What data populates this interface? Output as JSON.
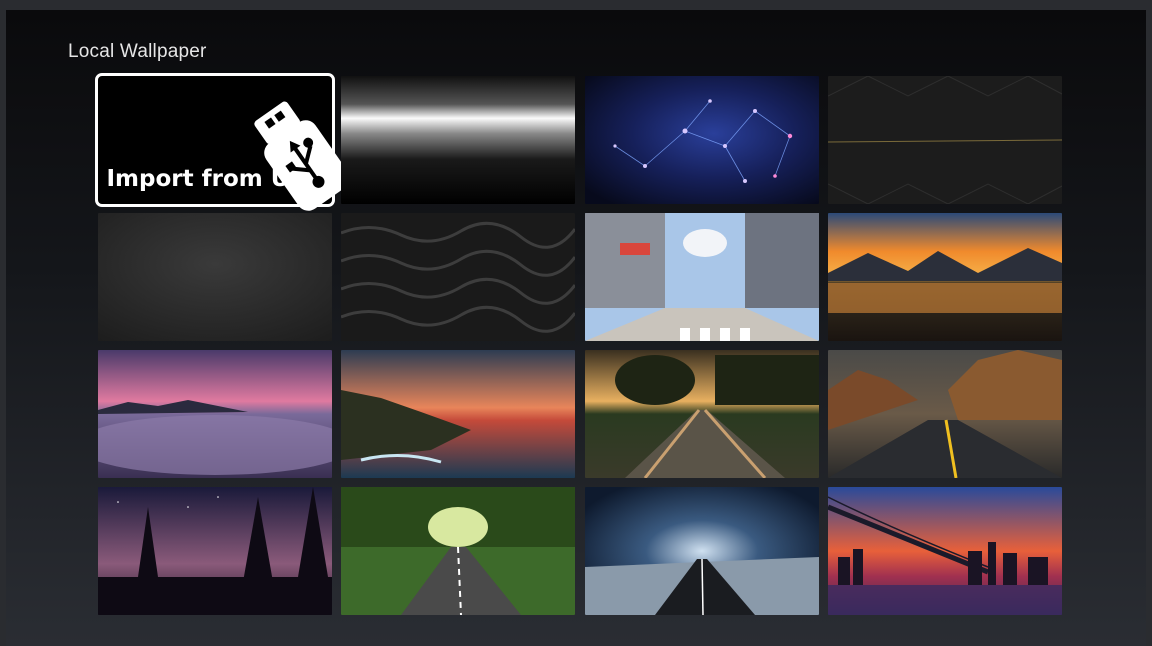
{
  "page": {
    "title": "Local Wallpaper"
  },
  "import_tile": {
    "label": "Import from USB",
    "icon": "usb-drive-icon"
  },
  "wallpapers": [
    {
      "name": "chrome-gradient"
    },
    {
      "name": "blue-network"
    },
    {
      "name": "dark-geometric"
    },
    {
      "name": "dark-concrete"
    },
    {
      "name": "dark-water"
    },
    {
      "name": "anime-street"
    },
    {
      "name": "sunset-lake"
    },
    {
      "name": "purple-clouds"
    },
    {
      "name": "coastal-sunset"
    },
    {
      "name": "railroad-tracks"
    },
    {
      "name": "autumn-road"
    },
    {
      "name": "starry-pines"
    },
    {
      "name": "tree-tunnel-road"
    },
    {
      "name": "stormy-road"
    },
    {
      "name": "city-bridge-sunset"
    }
  ]
}
